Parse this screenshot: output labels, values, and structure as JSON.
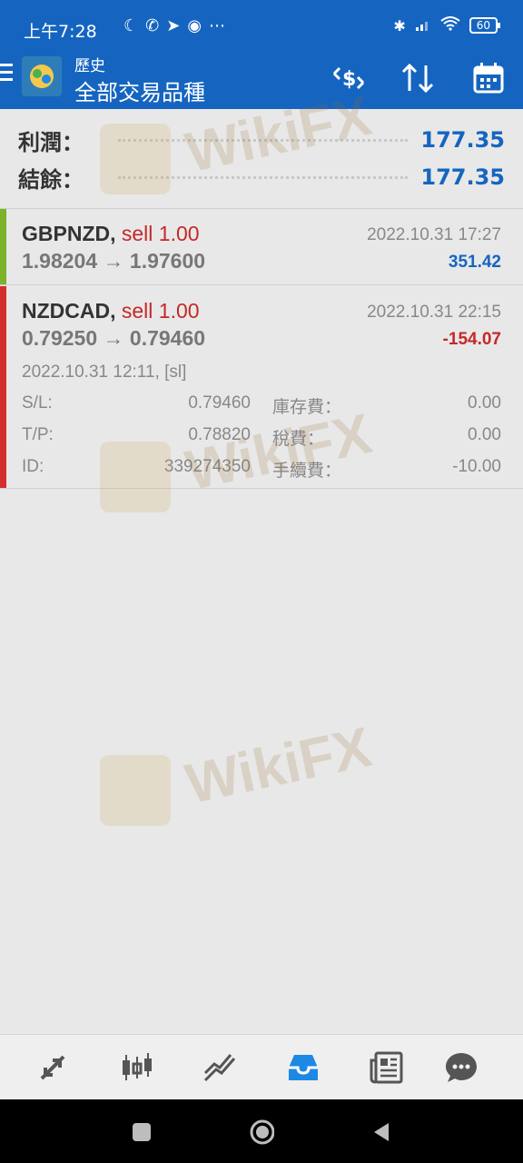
{
  "status_bar": {
    "time": "上午7:28",
    "battery": "60",
    "left_icons": [
      "moon-icon",
      "whatsapp-icon",
      "telegram-icon",
      "chrome-icon",
      "more-icon"
    ],
    "right_icons": [
      "bluetooth-icon",
      "signal-icon",
      "wifi-icon",
      "battery-icon"
    ]
  },
  "app_bar": {
    "subtitle": "歷史",
    "title": "全部交易品種",
    "actions": [
      "currency-swap-icon",
      "sort-icon",
      "calendar-icon"
    ],
    "colors": {
      "bar": "#1565c0"
    }
  },
  "summary": {
    "profit_label": "利潤：",
    "profit_value": "177.35",
    "balance_label": "結餘：",
    "balance_value": "177.35"
  },
  "trades": [
    {
      "symbol": "GBPNZD,",
      "side": "sell 1.00",
      "close_time": "2022.10.31 17:27",
      "prices": "1.98204 → 1.97600",
      "profit": "351.42",
      "bar_color": "#7cb32a",
      "profit_color": "#1565c0"
    },
    {
      "symbol": "NZDCAD,",
      "side": "sell 1.00",
      "close_time": "2022.10.31 22:15",
      "prices": "0.79250 → 0.79460",
      "profit": "-154.07",
      "bar_color": "#d32f2f",
      "profit_color": "#c62828",
      "open_info": "2022.10.31 12:11, [sl]",
      "details": [
        {
          "label1": "S/L:",
          "value1": "0.79460",
          "label2": "庫存費：",
          "value2": "0.00"
        },
        {
          "label1": "T/P:",
          "value1": "0.78820",
          "label2": "稅費：",
          "value2": "0.00"
        },
        {
          "label1": "ID:",
          "value1": "339274350",
          "label2": "手續費：",
          "value2": "-10.00"
        }
      ]
    }
  ],
  "watermark": {
    "text": "WikiFX"
  },
  "bottom_nav": [
    "trade-icon",
    "chart-icon",
    "trend-icon",
    "history-icon",
    "news-icon",
    "chat-icon"
  ],
  "system_nav": [
    "recents-icon",
    "home-icon",
    "back-icon"
  ]
}
